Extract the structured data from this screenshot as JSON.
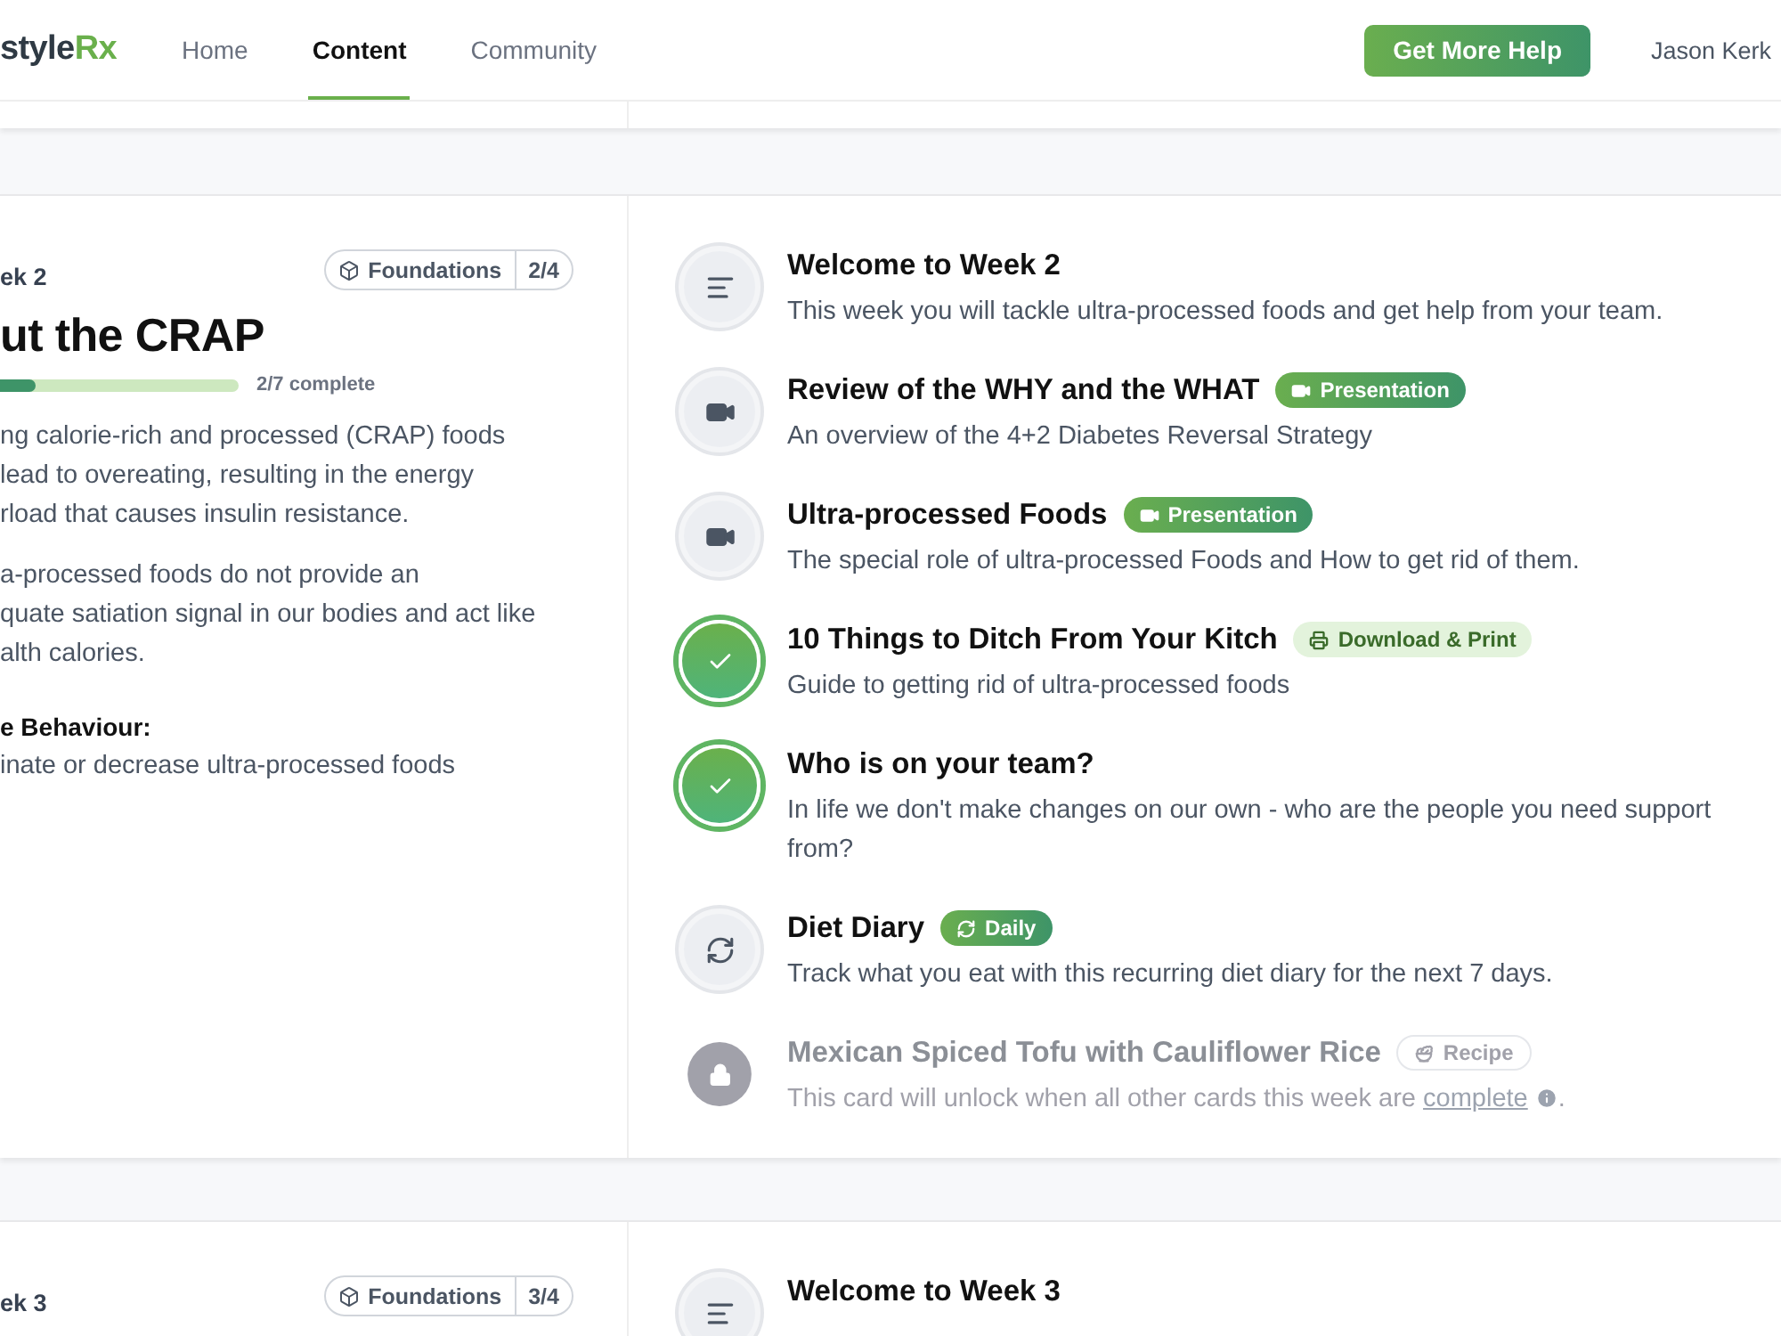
{
  "header": {
    "logo": {
      "dark": "style",
      "accent": "Rx"
    },
    "nav": [
      {
        "label": "Home",
        "selected": false
      },
      {
        "label": "Content",
        "selected": true
      },
      {
        "label": "Community",
        "selected": false
      }
    ],
    "help_button": "Get More Help",
    "user": "Jason Kerk"
  },
  "weeks": [
    {
      "week_label": "ek 2",
      "title": "ut the CRAP",
      "tag": {
        "label": "Foundations",
        "count": "2/4"
      },
      "progress": {
        "level": 0.15,
        "reading": "2/7 complete"
      },
      "paragraphs": [
        [
          "ng calorie-rich and processed (CRAP) foods",
          " lead to overeating, resulting in the energy",
          "rload that causes insulin resistance."
        ],
        [
          "a-processed foods do not provide an",
          "quate satiation signal in our bodies and act like",
          "alth calories."
        ]
      ],
      "behaviour": {
        "heading": "e Behaviour:",
        "text": "inate or decrease ultra-processed foods"
      },
      "cards": [
        {
          "title": "Welcome to Week 2",
          "kind": "article",
          "completed": false,
          "locked": false,
          "description": "This week you will tackle ultra-processed foods and get help from your team."
        },
        {
          "title": "Review of the WHY and the WHAT",
          "kind": "video",
          "completed": false,
          "locked": false,
          "badge": {
            "kind": "presentation",
            "label": "Presentation"
          },
          "description": "An overview of the 4+2 Diabetes Reversal Strategy"
        },
        {
          "title": "Ultra-processed Foods",
          "kind": "video",
          "completed": false,
          "locked": false,
          "badge": {
            "kind": "presentation",
            "label": "Presentation"
          },
          "description": "The special role of ultra-processed Foods and How to get rid of them."
        },
        {
          "title": "10 Things to Ditch From Your Kitch",
          "completed": true,
          "locked": false,
          "badge": {
            "kind": "download",
            "label": "Download & Print"
          },
          "description": "Guide to getting rid of ultra-processed foods"
        },
        {
          "title": "Who is on your team?",
          "completed": true,
          "locked": false,
          "description": "In life we don't make changes on our own - who are the people you need support from?"
        },
        {
          "title": "Diet Diary",
          "kind": "recurring",
          "completed": false,
          "locked": false,
          "badge": {
            "kind": "daily",
            "label": "Daily"
          },
          "description": "Track what you eat with this recurring diet diary for the next 7 days."
        },
        {
          "title": "Mexican Spiced Tofu with Cauliflower Rice",
          "locked": true,
          "badge": {
            "kind": "recipe",
            "label": "Recipe"
          },
          "description": "This card will unlock when all other cards this week are ",
          "link": "complete",
          "after": "."
        }
      ]
    },
    {
      "week_label": "ek 3",
      "tag": {
        "label": "Foundations",
        "count": "3/4"
      },
      "cards": [
        {
          "title": "Welcome to Week 3",
          "kind": "article",
          "completed": false,
          "locked": false
        }
      ]
    }
  ]
}
